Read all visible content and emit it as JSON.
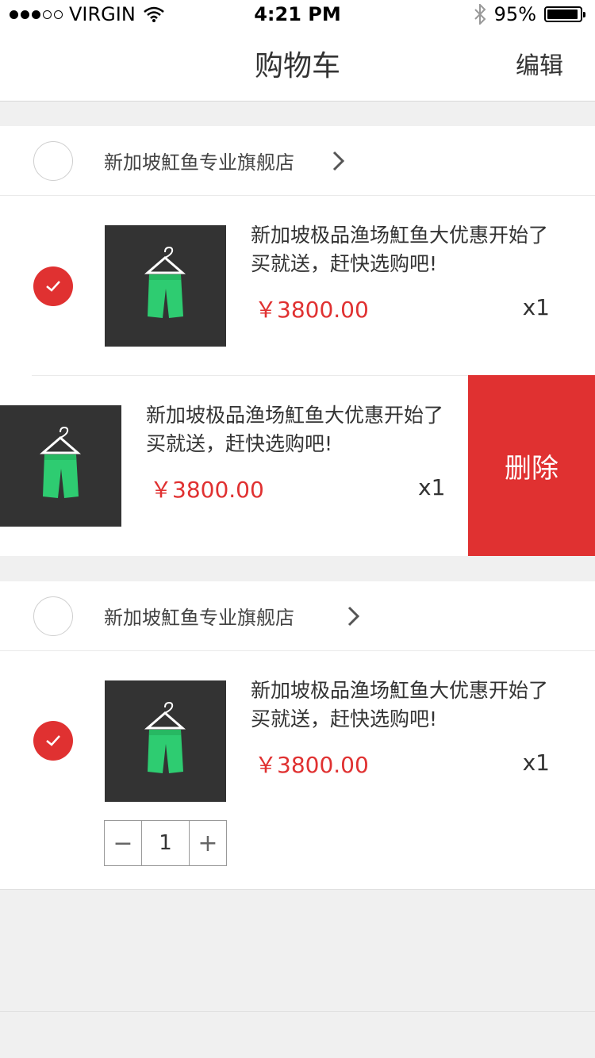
{
  "status_bar": {
    "carrier": "VIRGIN",
    "time": "4:21 PM",
    "battery": "95%",
    "battery_level": 0.95
  },
  "nav": {
    "title": "购物车",
    "edit": "编辑"
  },
  "stores": [
    {
      "name": "新加坡魟鱼专业旗舰店",
      "checked": false,
      "items": [
        {
          "title": "新加坡极品渔场魟鱼大优惠开始了买就送，赶快选购吧!",
          "price": "￥3800.00",
          "qty": "x1",
          "checked": true
        },
        {
          "title": "新加坡极品渔场魟鱼大优惠开始了买就送，赶快选购吧!",
          "price": "￥3800.00",
          "qty": "x1",
          "delete_label": "删除"
        }
      ]
    },
    {
      "name": "新加坡魟鱼专业旗舰店",
      "checked": false,
      "items": [
        {
          "title": "新加坡极品渔场魟鱼大优惠开始了买就送，赶快选购吧!",
          "price": "￥3800.00",
          "qty": "x1",
          "checked": true,
          "stepper": {
            "minus": "−",
            "value": "1",
            "plus": "+"
          }
        }
      ]
    }
  ],
  "colors": {
    "accent": "#e03131",
    "image_bg": "#333333",
    "garment": "#2ecc71"
  }
}
